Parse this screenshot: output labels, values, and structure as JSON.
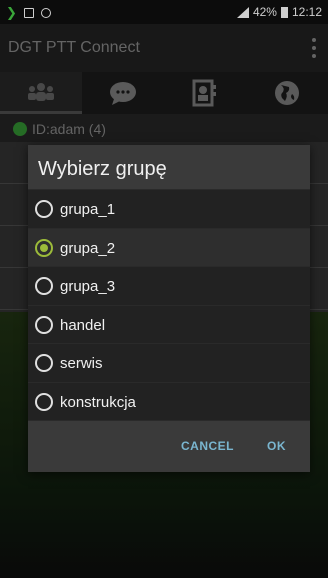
{
  "status_bar": {
    "battery": "42%",
    "time": "12:12"
  },
  "app_bar": {
    "title": "DGT PTT Connect"
  },
  "tabs": [
    {
      "icon": "group-icon"
    },
    {
      "icon": "chat-icon"
    },
    {
      "icon": "contacts-icon"
    },
    {
      "icon": "globe-icon"
    }
  ],
  "user_row": {
    "label": "ID:adam (4)"
  },
  "dialog": {
    "title": "Wybierz grupę",
    "options": [
      {
        "label": "grupa_1",
        "selected": false
      },
      {
        "label": "grupa_2",
        "selected": true
      },
      {
        "label": "grupa_3",
        "selected": false
      },
      {
        "label": "handel",
        "selected": false
      },
      {
        "label": "serwis",
        "selected": false
      },
      {
        "label": "konstrukcja",
        "selected": false
      }
    ],
    "cancel_label": "CANCEL",
    "ok_label": "OK"
  },
  "colors": {
    "accent": "#9cbb3a",
    "button": "#7ab6d0",
    "online": "#3aa63a"
  }
}
